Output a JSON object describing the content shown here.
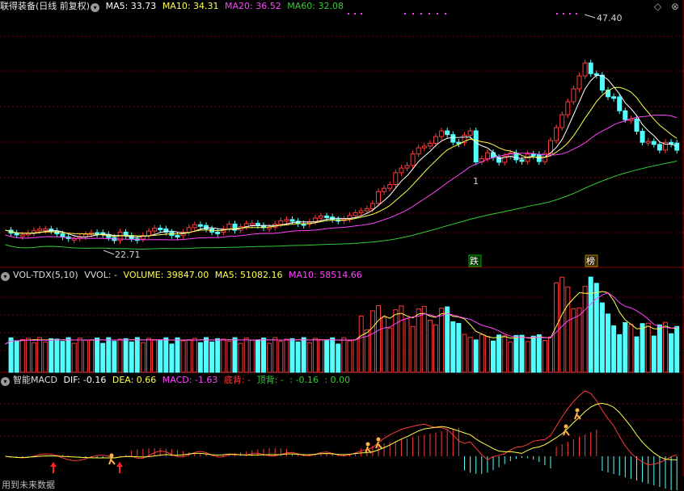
{
  "price_panel": {
    "title": "联得装备(日线 前复权)",
    "ma5": "MA5: 33.73",
    "ma10": "MA10: 34.31",
    "ma20": "MA20: 36.52",
    "ma60": "MA60: 32.08",
    "high_label": "47.40",
    "low_label": "22.71",
    "marker_1": "1",
    "tag_die": "跌",
    "tag_bang": "榜"
  },
  "volume_panel": {
    "title": "VOL-TDX(5,10)",
    "vvol": "VVOL: -",
    "volume": "VOLUME: 39847.00",
    "ma5": "MA5: 51082.16",
    "ma10": "MA10: 58514.66"
  },
  "macd_panel": {
    "title": "智能MACD",
    "dif": "DIF: -0.16",
    "dea": "DEA: 0.66",
    "macd": "MACD: -1.63",
    "dibei": "底背: -",
    "dingbei": "顶背: -",
    "v1": ": -0.16",
    "v2": ": 0.00"
  },
  "top_right_icons": "◇ ⊗",
  "bottom_note": "用到未来数据",
  "colors": {
    "up": "#ff3a3a",
    "down": "#54ffff",
    "ma5": "#ffffff",
    "ma10": "#ffff4a",
    "ma20": "#ff44ff",
    "ma60": "#33cc33",
    "grid": "#7a0000"
  }
}
